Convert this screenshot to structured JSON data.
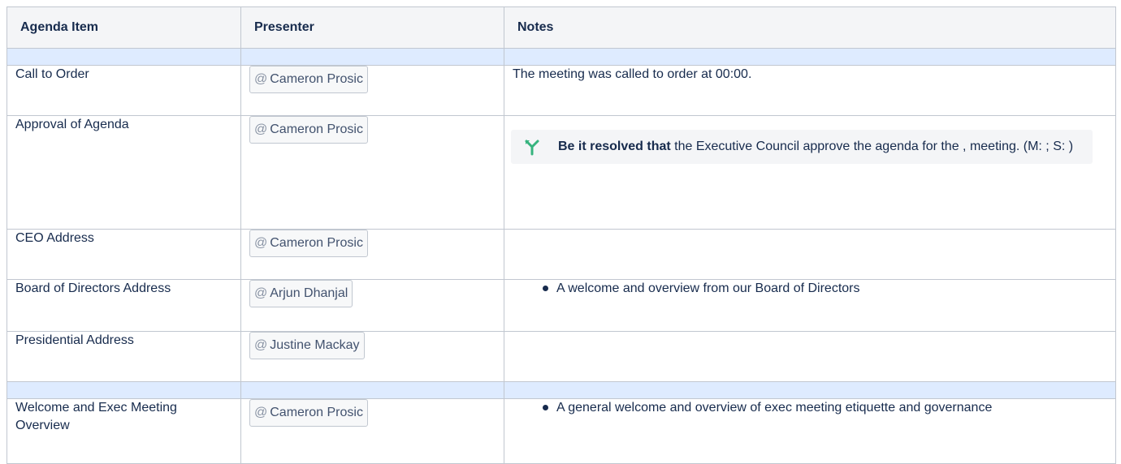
{
  "table": {
    "headers": [
      "Agenda Item",
      "Presenter",
      "Notes"
    ],
    "rows": [
      {
        "item": "Call to Order",
        "presenter": "Cameron Prosic",
        "note": "The meeting was called to order at 00:00."
      },
      {
        "item": "Approval of Agenda",
        "presenter": "Cameron Prosic",
        "decision_bold": "Be it resolved that",
        "decision_text": " the Executive Council approve the agenda for the , meeting. (M: ; S: )"
      },
      {
        "item": "CEO Address",
        "presenter": "Cameron Prosic"
      },
      {
        "item": "Board of Directors Address",
        "presenter": "Arjun Dhanjal",
        "bullet": "A welcome and overview from our Board of Directors"
      },
      {
        "item": "Presidential Address",
        "presenter": "Justine Mackay"
      },
      {
        "item": "Welcome and Exec Meeting Overview",
        "presenter": "Cameron Prosic",
        "bullet": "A general welcome and overview of exec meeting etiquette and governance"
      }
    ]
  },
  "mention_symbol": "@",
  "colors": {
    "header_bg": "#f4f5f7",
    "separator_bg": "#deebff",
    "decision_icon": "#36b37e"
  }
}
